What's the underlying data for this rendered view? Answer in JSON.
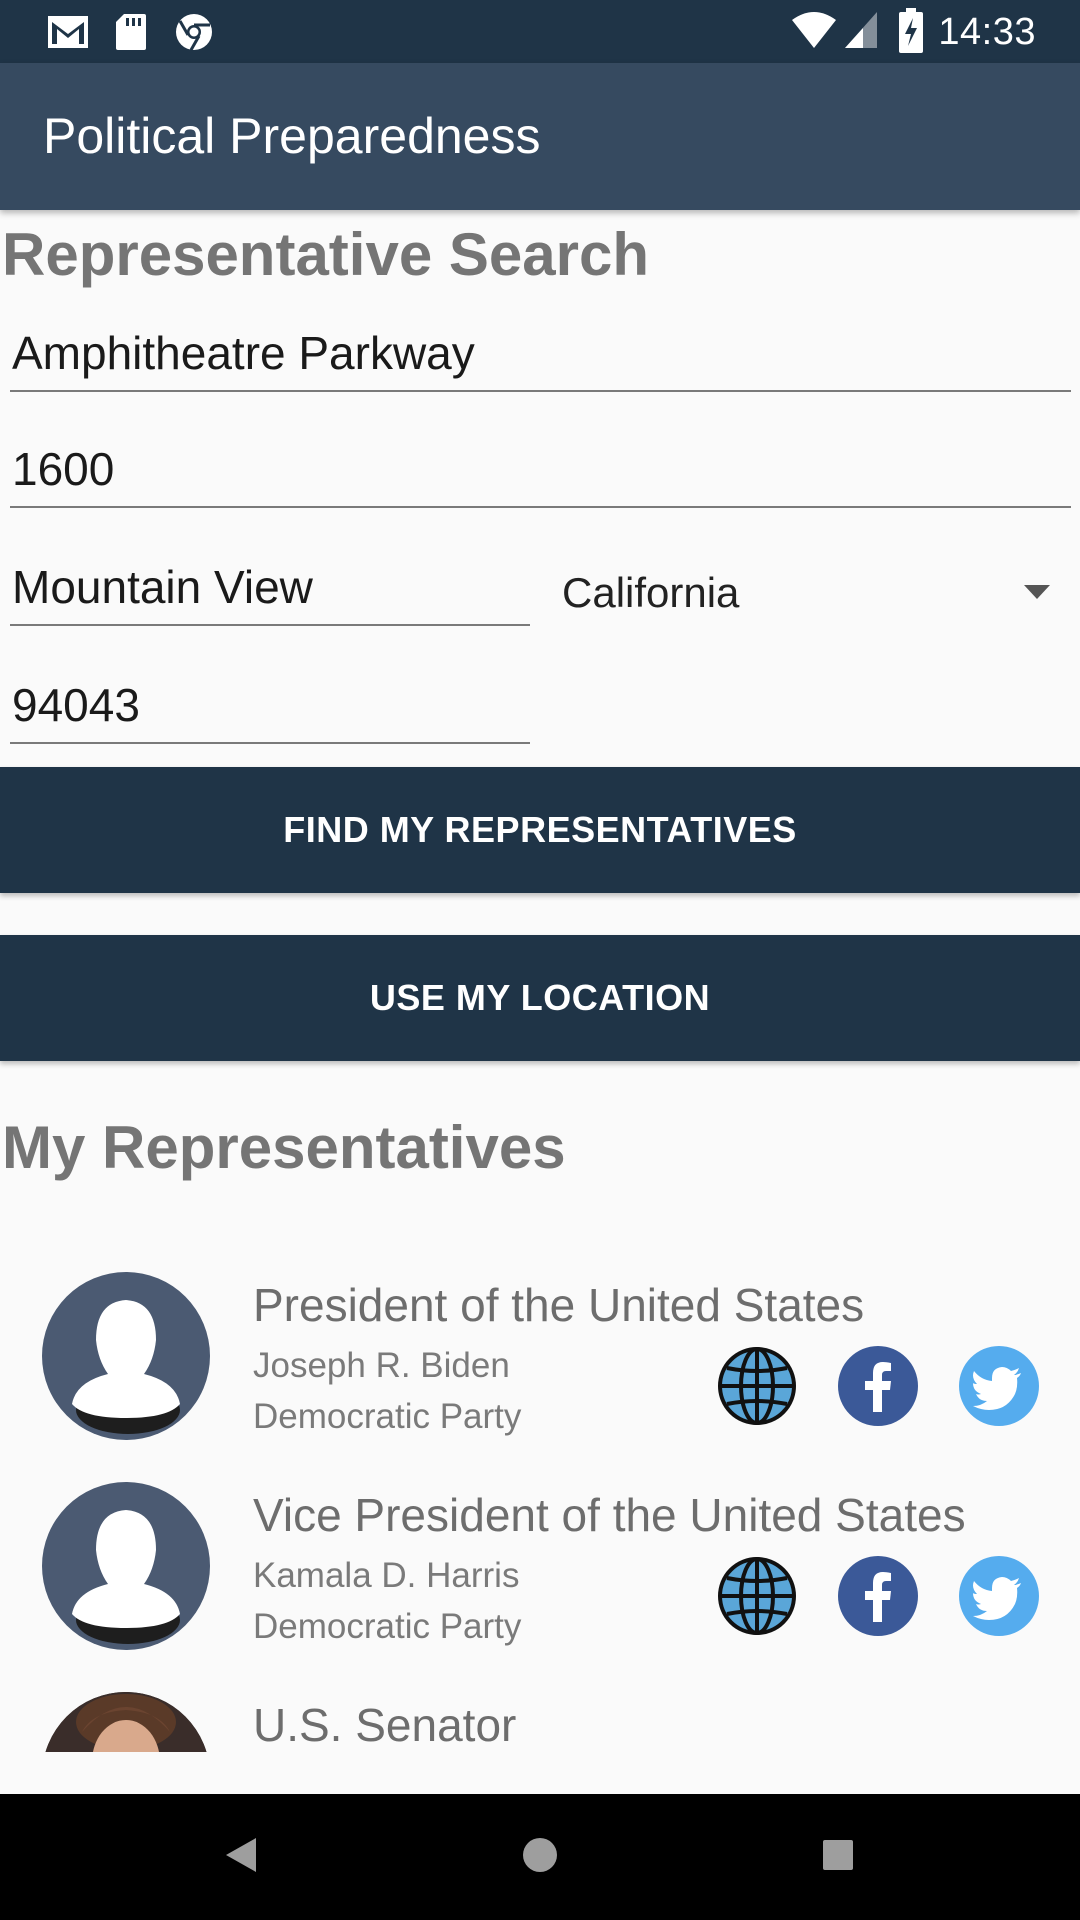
{
  "status_bar": {
    "time": "14:33",
    "icons": [
      "gmail-icon",
      "sd-card-icon",
      "chrome-icon",
      "wifi-icon",
      "signal-icon",
      "battery-charging-icon"
    ]
  },
  "app_bar": {
    "title": "Political Preparedness"
  },
  "search": {
    "heading": "Representative Search",
    "address_line1": "Amphitheatre Parkway",
    "address_line2": "1600",
    "city": "Mountain View",
    "state": "California",
    "zip": "94043",
    "find_button": "FIND MY REPRESENTATIVES",
    "location_button": "USE MY LOCATION"
  },
  "representatives": {
    "heading": "My Representatives",
    "items": [
      {
        "office": "President of the United States",
        "name": "Joseph R. Biden",
        "party": "Democratic Party",
        "links": [
          "globe-icon",
          "facebook-icon",
          "twitter-icon"
        ]
      },
      {
        "office": "Vice President of the United States",
        "name": "Kamala D. Harris",
        "party": "Democratic Party",
        "links": [
          "globe-icon",
          "facebook-icon",
          "twitter-icon"
        ]
      },
      {
        "office": "U.S. Senator"
      }
    ]
  },
  "nav_bar": {
    "buttons": [
      "back-icon",
      "home-icon",
      "recents-icon"
    ]
  },
  "colors": {
    "status_bar": "#1f3447",
    "app_bar": "#364a60",
    "button": "#1f3447",
    "facebook": "#3b5998",
    "twitter": "#55acee",
    "avatar": "#4b5a72"
  }
}
